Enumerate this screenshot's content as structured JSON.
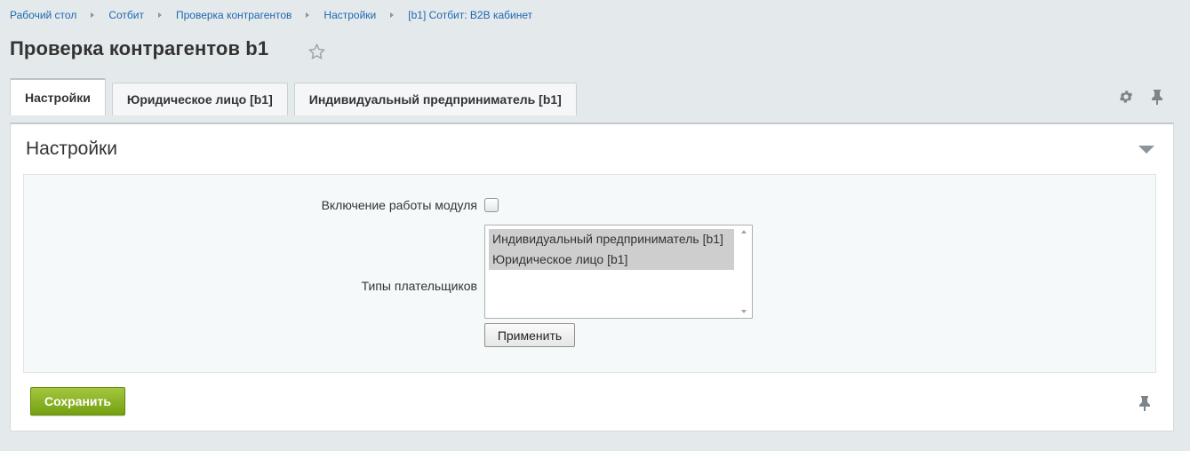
{
  "breadcrumb": {
    "items": [
      "Рабочий стол",
      "Сотбит",
      "Проверка контрагентов",
      "Настройки",
      "[b1] Сотбит: B2B кабинет"
    ]
  },
  "page": {
    "title": "Проверка контрагентов b1"
  },
  "tabs": [
    {
      "label": "Настройки",
      "active": true
    },
    {
      "label": "Юридическое лицо [b1]",
      "active": false
    },
    {
      "label": "Индивидуальный предприниматель [b1]",
      "active": false
    }
  ],
  "header_icons": {
    "settings": "gear-icon",
    "pin": "pin-icon",
    "favorite": "star-icon"
  },
  "panel": {
    "title": "Настройки",
    "fields": {
      "module_enable_label": "Включение работы модуля",
      "module_enable_checked": false,
      "payer_types_label": "Типы плательщиков",
      "payer_types_options": [
        {
          "label": "Индивидуальный предприниматель [b1]",
          "selected": true
        },
        {
          "label": "Юридическое лицо [b1]",
          "selected": true
        }
      ],
      "apply_label": "Применить"
    },
    "save_label": "Сохранить"
  },
  "colors": {
    "background": "#e4eaec",
    "link": "#2067b0",
    "save_button": "#8ab52a",
    "selected_option": "#cecece"
  }
}
